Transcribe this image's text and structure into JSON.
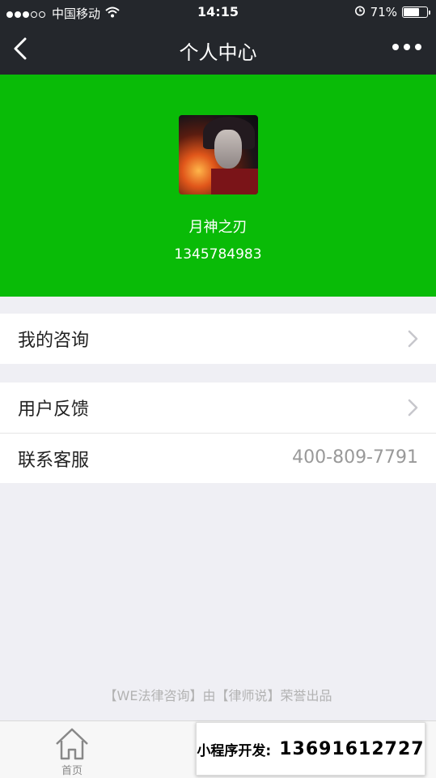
{
  "status_bar": {
    "carrier": "中国移动",
    "time": "14:15",
    "battery_percent_text": "71%",
    "battery_level": 0.71,
    "signal_strength": 3,
    "icons": [
      "wifi-icon",
      "alarm-icon",
      "battery-icon"
    ]
  },
  "nav": {
    "title": "个人中心",
    "back_icon": "chevron-left-icon",
    "more_icon": "more-dots-icon"
  },
  "profile": {
    "bg_color": "#09bb07",
    "username": "月神之刃",
    "phone": "1345784983"
  },
  "menu": {
    "group1": [
      {
        "label": "我的咨询",
        "icon": "chevron-right-icon"
      }
    ],
    "group2": [
      {
        "label": "用户反馈",
        "icon": "chevron-right-icon"
      },
      {
        "label": "联系客服",
        "value": "400-809-7791"
      }
    ]
  },
  "footer": {
    "credit": "【WE法律咨询】由【律师说】荣誉出品"
  },
  "tabbar": {
    "home_label": "首页",
    "home_icon": "home-icon"
  },
  "promo": {
    "label": "小程序开发:",
    "number": "13691612727"
  }
}
